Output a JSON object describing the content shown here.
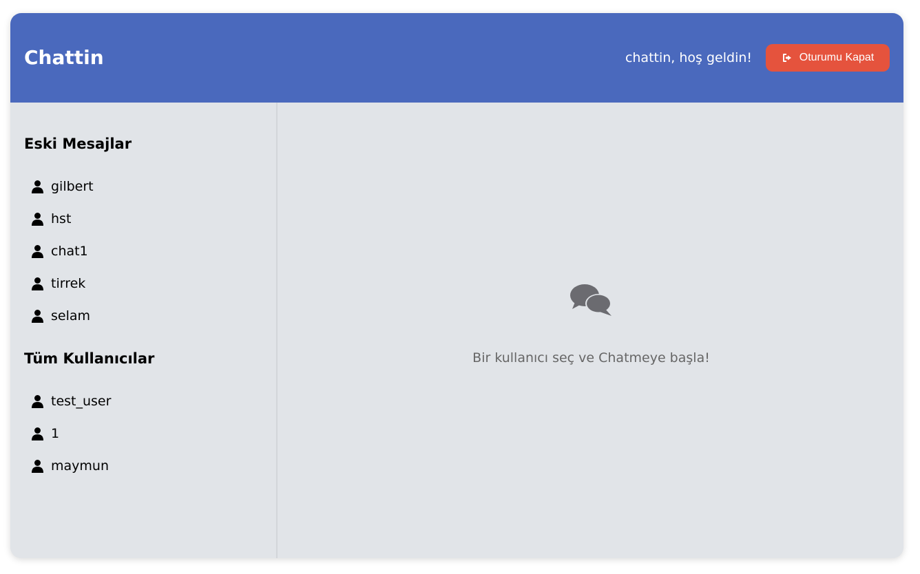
{
  "header": {
    "brand": "Chattin",
    "welcome": "chattin, hoş geldin!",
    "logout_label": "Oturumu Kapat",
    "logout_icon": "sign-out-icon",
    "logout_color": "#e5533d",
    "background_color": "#4a69bd"
  },
  "sidebar": {
    "old_messages_title": "Eski Mesajlar",
    "old_messages": [
      {
        "name": "gilbert",
        "icon": "user-icon"
      },
      {
        "name": "hst",
        "icon": "user-icon"
      },
      {
        "name": "chat1",
        "icon": "user-icon"
      },
      {
        "name": "tirrek",
        "icon": "user-icon"
      },
      {
        "name": "selam",
        "icon": "user-icon"
      }
    ],
    "all_users_title": "Tüm Kullanıcılar",
    "all_users": [
      {
        "name": "test_user",
        "icon": "user-icon"
      },
      {
        "name": "1",
        "icon": "user-icon"
      },
      {
        "name": "maymun",
        "icon": "user-icon"
      }
    ]
  },
  "main": {
    "empty_icon": "comments-icon",
    "empty_text": "Bir kullanıcı seç ve Chatmeye başla!"
  }
}
